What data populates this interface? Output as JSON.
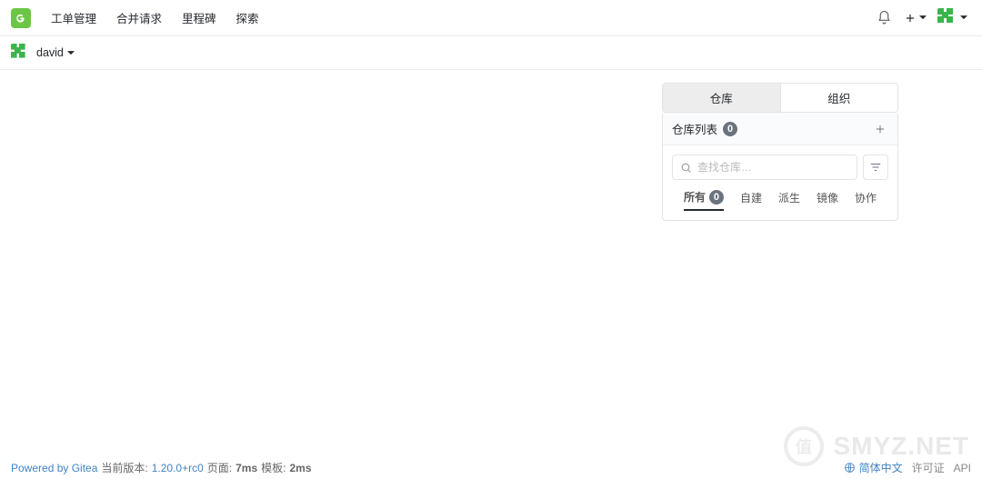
{
  "nav": {
    "items": [
      "工单管理",
      "合并请求",
      "里程碑",
      "探索"
    ]
  },
  "user": {
    "name": "david"
  },
  "switchTabs": {
    "repo": "仓库",
    "org": "组织"
  },
  "repoPanel": {
    "title": "仓库列表",
    "count": "0",
    "searchPlaceholder": "查找仓库…",
    "tabs": {
      "all": "所有",
      "allCount": "0",
      "sources": "自建",
      "forks": "派生",
      "mirrors": "镜像",
      "collab": "协作"
    }
  },
  "footer": {
    "poweredBy": "Powered by Gitea",
    "versionLabel": "当前版本:",
    "version": "1.20.0+rc0",
    "pageLabel": "页面:",
    "pageTime": "7ms",
    "tmplLabel": "模板:",
    "tmplTime": "2ms",
    "lang": "简体中文",
    "license": "许可证",
    "api": "API"
  },
  "watermark": {
    "circle": "值",
    "text": "SMYZ.NET"
  }
}
